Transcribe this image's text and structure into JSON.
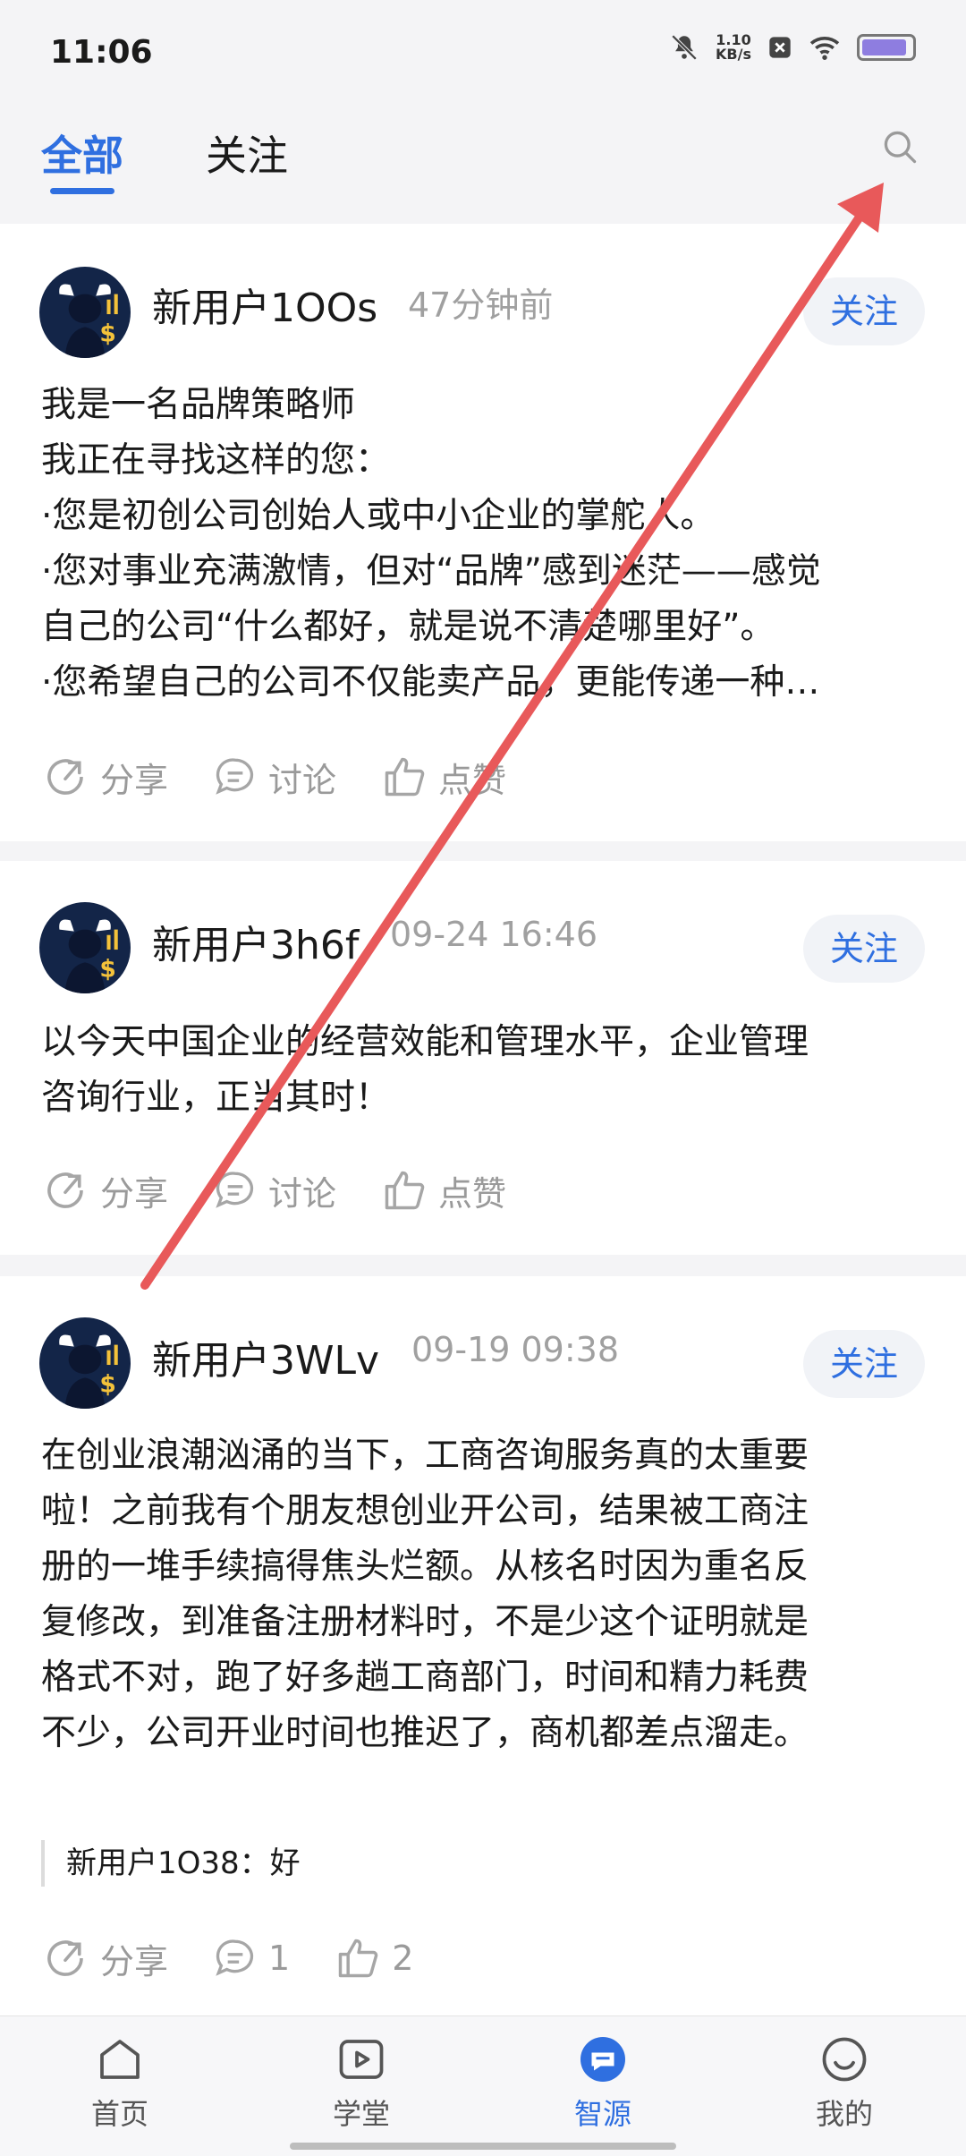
{
  "status_bar": {
    "time": "11:06",
    "net_speed_value": "1.10",
    "net_speed_unit": "KB/s",
    "battery_level": 0.9
  },
  "top_tabs": {
    "active": "全部",
    "follow": "关注"
  },
  "posts": [
    {
      "username": "新用户1OOs",
      "time": "47分钟前",
      "follow_label": "关注",
      "lines": [
        "我是一名品牌策略师",
        "我正在寻找这样的您：",
        "·您是初创公司创始人或中小企业的掌舵人。",
        "·您对事业充满激情，但对“品牌”感到迷茫——感觉",
        "自己的公司“什么都好，就是说不清楚哪里好”。",
        "·您希望自己的公司不仅能卖产品，更能传递一种…"
      ],
      "actions": {
        "share": "分享",
        "discuss": "讨论",
        "like": "点赞"
      }
    },
    {
      "username": "新用户3h6f",
      "time": "09-24 16:46",
      "follow_label": "关注",
      "lines": [
        "以今天中国企业的经营效能和管理水平，企业管理",
        "咨询行业，正当其时！"
      ],
      "actions": {
        "share": "分享",
        "discuss": "讨论",
        "like": "点赞"
      }
    },
    {
      "username": "新用户3WLv",
      "time": "09-19 09:38",
      "follow_label": "关注",
      "lines": [
        "在创业浪潮汹涌的当下，工商咨询服务真的太重要",
        "啦！之前我有个朋友想创业开公司，结果被工商注",
        "册的一堆手续搞得焦头烂额。从核名时因为重名反",
        "复修改，到准备注册材料时，不是少这个证明就是",
        "格式不对，跑了好多趟工商部门，时间和精力耗费",
        "不少，公司开业时间也推迟了，商机都差点溜走。"
      ],
      "reply": "新用户1O38：好",
      "actions": {
        "share": "分享",
        "discuss": "1",
        "like": "2"
      }
    }
  ],
  "bottom_nav": [
    {
      "label": "首页",
      "icon": "home-icon"
    },
    {
      "label": "学堂",
      "icon": "play-icon"
    },
    {
      "label": "智源",
      "icon": "chat-icon",
      "active": true
    },
    {
      "label": "我的",
      "icon": "smile-icon"
    }
  ],
  "colors": {
    "accent": "#2f6fe0",
    "annotation_arrow": "#e8595a"
  }
}
